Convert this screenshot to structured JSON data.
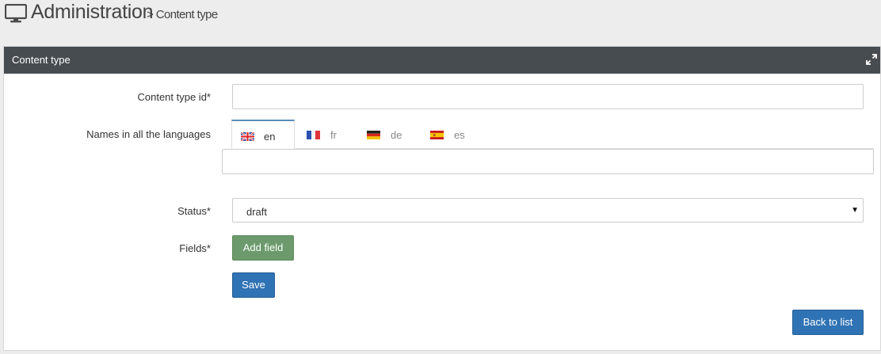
{
  "header": {
    "title": "Administration",
    "breadcrumb": "> Content type",
    "icon": "monitor-icon"
  },
  "panel": {
    "title": "Content type",
    "expand_icon": "expand-icon"
  },
  "form": {
    "content_type_id": {
      "label": "Content type id*",
      "value": ""
    },
    "names": {
      "label": "Names in all the languages",
      "value": "",
      "tabs": [
        {
          "code": "en",
          "flag": "uk-flag-icon",
          "active": true
        },
        {
          "code": "fr",
          "flag": "france-flag-icon",
          "active": false
        },
        {
          "code": "de",
          "flag": "germany-flag-icon",
          "active": false
        },
        {
          "code": "es",
          "flag": "spain-flag-icon",
          "active": false
        }
      ]
    },
    "status": {
      "label": "Status*",
      "selected": "draft"
    },
    "fields": {
      "label": "Fields*",
      "add_label": "Add field"
    },
    "save_label": "Save",
    "back_label": "Back to list"
  },
  "colors": {
    "panel_heading": "#474c51",
    "primary": "#2f73b4",
    "success": "#6c9a6c",
    "tab_accent": "#5b8cbb"
  }
}
